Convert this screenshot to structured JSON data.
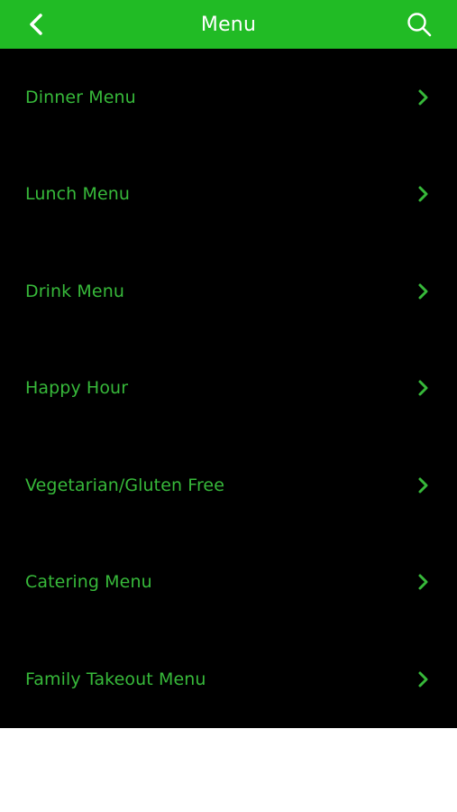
{
  "header": {
    "title": "Menu",
    "back_icon": "chevron-left-icon",
    "search_icon": "search-icon"
  },
  "colors": {
    "header_bg": "#21bb25",
    "list_bg": "#000000",
    "item_text": "#37b93a",
    "chevron": "#37b93a"
  },
  "menu": {
    "items": [
      {
        "label": "Dinner Menu"
      },
      {
        "label": "Lunch Menu"
      },
      {
        "label": "Drink Menu"
      },
      {
        "label": "Happy Hour"
      },
      {
        "label": "Vegetarian/Gluten Free"
      },
      {
        "label": "Catering Menu"
      },
      {
        "label": "Family Takeout Menu"
      }
    ]
  }
}
